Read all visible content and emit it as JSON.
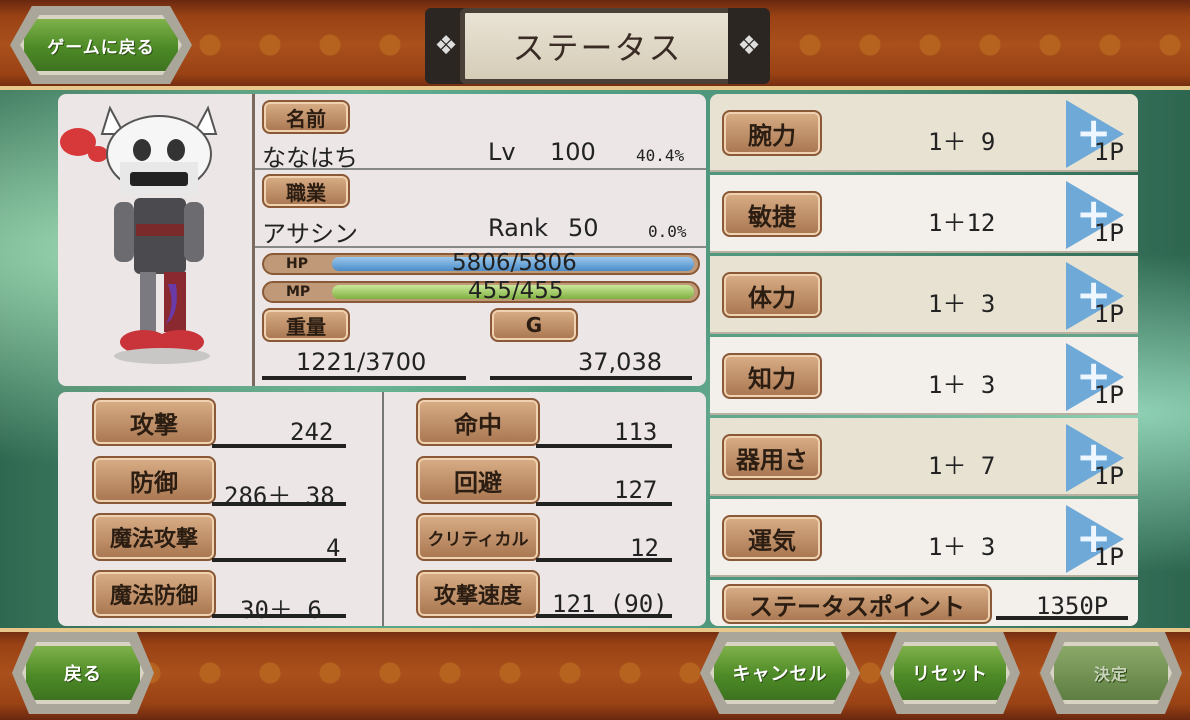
{
  "header": {
    "back_game": "ゲームに戻る",
    "title": "ステータス"
  },
  "profile": {
    "name_label": "名前",
    "name": "ななはち",
    "lv_label": "Lv",
    "lv": "100",
    "lv_pct": "40.4%",
    "job_label": "職業",
    "job": "アサシン",
    "rank_label": "Rank",
    "rank": "50",
    "rank_pct": "0.0%",
    "hp_label": "HP",
    "hp": "5806/5806",
    "mp_label": "MP",
    "mp": "455/455",
    "weight_label": "重量",
    "weight": "1221/3700",
    "gold_label": "G",
    "gold": "37,038"
  },
  "combat": [
    {
      "label": "攻撃",
      "value": "242"
    },
    {
      "label": "防御",
      "value": "286＋ 38"
    },
    {
      "label": "魔法攻撃",
      "value": "4"
    },
    {
      "label": "魔法防御",
      "value": "30＋  6"
    },
    {
      "label": "命中",
      "value": "113"
    },
    {
      "label": "回避",
      "value": "127"
    },
    {
      "label": "クリティカル",
      "value": "12"
    },
    {
      "label": "攻撃速度",
      "value": "121 (90)"
    }
  ],
  "stats": [
    {
      "label": "腕力",
      "value": "1＋  9",
      "pt": "1P"
    },
    {
      "label": "敏捷",
      "value": "1＋12",
      "pt": "1P"
    },
    {
      "label": "体力",
      "value": "1＋  3",
      "pt": "1P"
    },
    {
      "label": "知力",
      "value": "1＋  3",
      "pt": "1P"
    },
    {
      "label": "器用さ",
      "value": "1＋  7",
      "pt": "1P"
    },
    {
      "label": "運気",
      "value": "1＋  3",
      "pt": "1P"
    }
  ],
  "status_points": {
    "label": "ステータスポイント",
    "value": "1350P"
  },
  "footer": {
    "back": "戻る",
    "cancel": "キャンセル",
    "reset": "リセット",
    "confirm": "決定"
  }
}
